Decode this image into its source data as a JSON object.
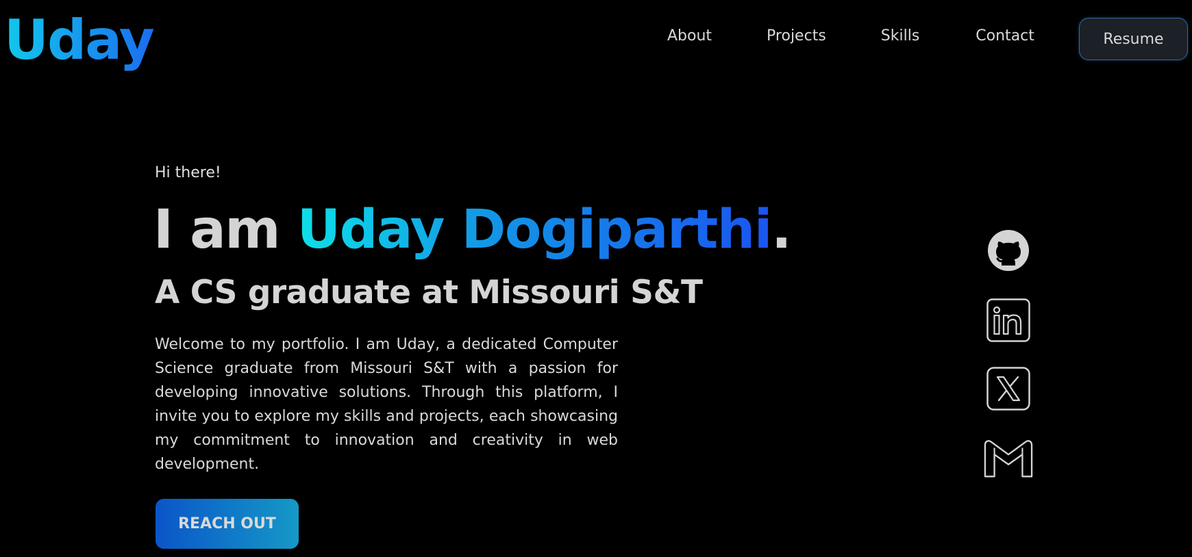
{
  "header": {
    "logo": "Uday",
    "nav": {
      "about": "About",
      "projects": "Projects",
      "skills": "Skills",
      "contact": "Contact"
    },
    "resume_label": "Resume"
  },
  "hero": {
    "greeting": "Hi there!",
    "headline_prefix": "I am ",
    "headline_name": "Uday Dogiparthi",
    "headline_suffix": ".",
    "subheadline": "A CS graduate at Missouri S&T",
    "intro": "Welcome to my portfolio. I am Uday, a dedicated Computer Science graduate from Missouri S&T with a passion for developing innovative solutions. Through this platform, I invite you to explore my skills and projects, each showcasing my commitment to innovation and creativity in web development.",
    "cta_label": "REACH OUT"
  },
  "social": [
    {
      "icon": "github-icon"
    },
    {
      "icon": "linkedin-icon"
    },
    {
      "icon": "x-icon"
    },
    {
      "icon": "gmail-icon"
    }
  ],
  "colors": {
    "background": "#000000",
    "text": "#d4d4d4",
    "accent_start": "#0ee0e8",
    "accent_end": "#1a55f0",
    "resume_border": "#2f6ba8"
  }
}
